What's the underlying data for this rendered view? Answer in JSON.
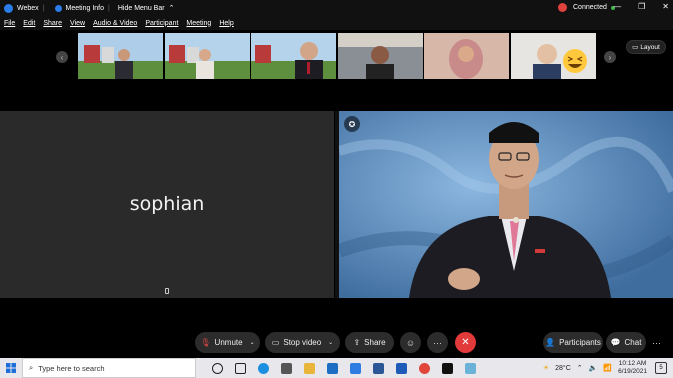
{
  "titlebar": {
    "app_name": "Webex",
    "meeting_info": "Meeting Info",
    "hide_menu_bar": "Hide Menu Bar",
    "status": "Connected",
    "minimize": "—",
    "restore": "❐",
    "close": "✕"
  },
  "menu": [
    "File",
    "Edit",
    "Share",
    "View",
    "Audio & Video",
    "Participant",
    "Meeting",
    "Help"
  ],
  "layout_button": "Layout",
  "active_speaker": {
    "name_label": "sophian"
  },
  "controls": {
    "unmute": "Unmute",
    "stop_video": "Stop video",
    "share": "Share",
    "participants": "Participants",
    "chat": "Chat",
    "more": "···"
  },
  "taskbar": {
    "search_placeholder": "Type here to search",
    "temperature": "28°C",
    "time": "10:12 AM",
    "date": "6/19/2021",
    "notification_count": "5"
  },
  "colors": {
    "end_call": "#e23a3a",
    "recording": "#e0423e",
    "connected_dot": "#3cb54a"
  }
}
